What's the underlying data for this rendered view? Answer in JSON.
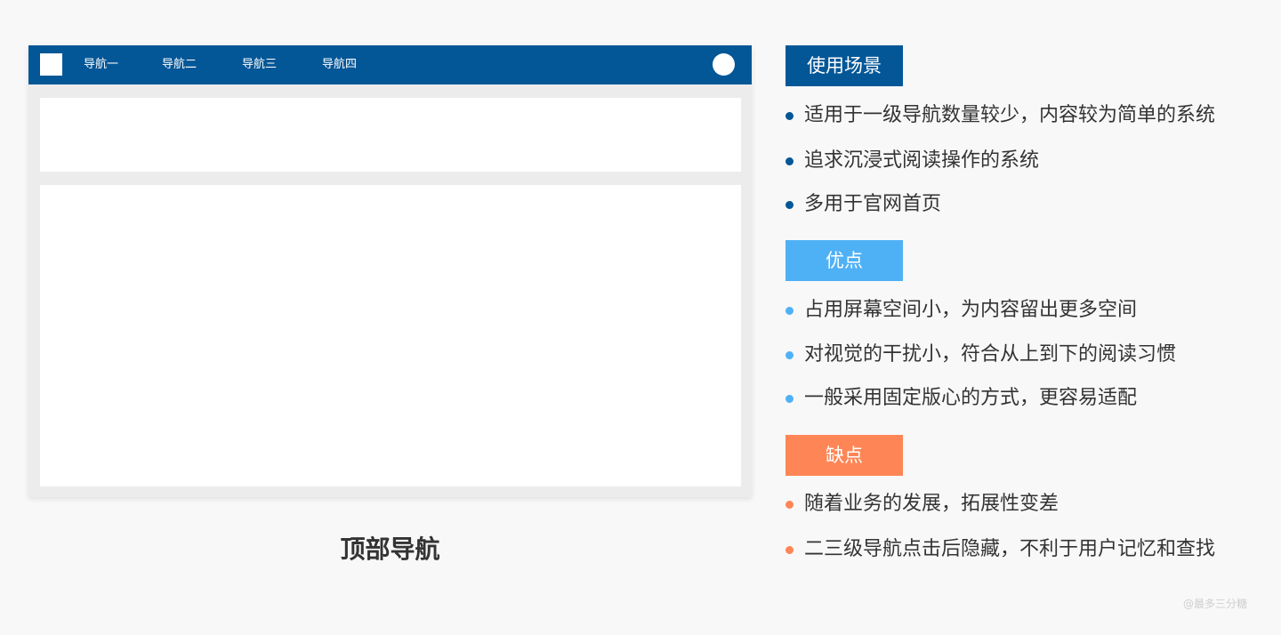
{
  "mockup": {
    "nav_items": [
      "导航一",
      "导航二",
      "导航三",
      "导航四"
    ],
    "caption": "顶部导航"
  },
  "colors": {
    "primary": "#045797",
    "pros": "#4fb1f5",
    "cons": "#fe8656"
  },
  "sections": {
    "usage": {
      "title": "使用场景",
      "items": [
        "适用于一级导航数量较少，内容较为简单的系统",
        "追求沉浸式阅读操作的系统",
        "多用于官网首页"
      ]
    },
    "pros": {
      "title": "优点",
      "items": [
        "占用屏幕空间小，为内容留出更多空间",
        "对视觉的干扰小，符合从上到下的阅读习惯",
        "一般采用固定版心的方式，更容易适配"
      ]
    },
    "cons": {
      "title": "缺点",
      "items": [
        "随着业务的发展，拓展性变差",
        "二三级导航点击后隐藏，不利于用户记忆和查找"
      ]
    }
  },
  "watermark": "@最多三分糖"
}
